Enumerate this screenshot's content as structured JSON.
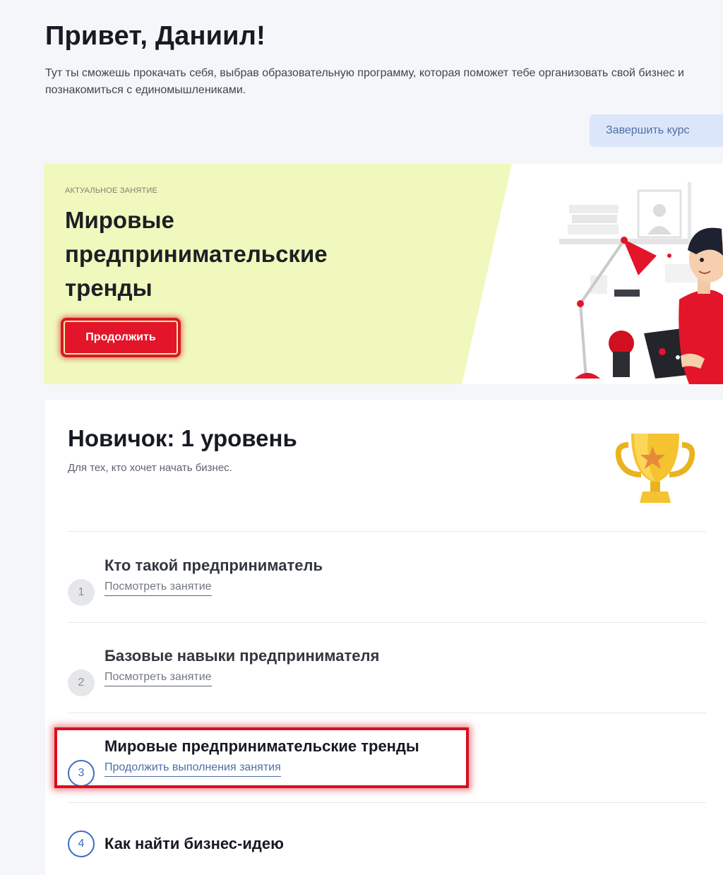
{
  "header": {
    "greeting": "Привет, Даниил!",
    "intro": "Тут ты сможешь прокачать себя, выбрав образовательную программу, которая поможет тебе организовать свой бизнес и познакомиться с единомышлениками.",
    "finish_button": "Завершить курс"
  },
  "current_lesson": {
    "label": "Актуальное занятие",
    "title": "Мировые предпринимательские тренды",
    "continue_button": "Продолжить",
    "illustration_icon": "man-at-laptop-illustration"
  },
  "level": {
    "title": "Новичок: 1 уровень",
    "subtitle": "Для тех, кто хочет начать бизнес.",
    "icon": "trophy-icon",
    "lessons": [
      {
        "number": "1",
        "title": "Кто такой предприниматель",
        "link": "Посмотреть занятие",
        "state": "done"
      },
      {
        "number": "2",
        "title": "Базовые навыки предпринимателя",
        "link": "Посмотреть занятие",
        "state": "done"
      },
      {
        "number": "3",
        "title": "Мировые предпринимательские тренды",
        "link": "Продолжить выполнения занятия",
        "state": "current"
      },
      {
        "number": "4",
        "title": "Как найти бизнес-идею",
        "link": "",
        "state": "upcoming"
      }
    ]
  },
  "colors": {
    "accent_red": "#e3152a",
    "banner_green": "#f0f8bd",
    "link_blue": "#4d6ea8",
    "button_light_blue": "#dbe6fb"
  }
}
